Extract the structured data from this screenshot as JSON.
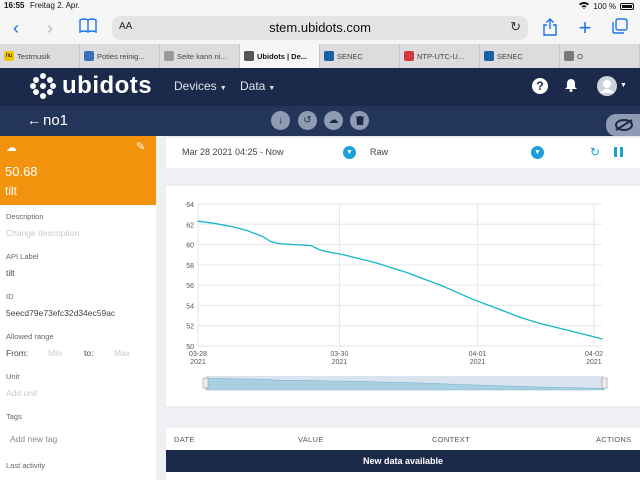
{
  "status_bar": {
    "time": "16:55",
    "date": "Freitag 2. Apr.",
    "battery": "100 %"
  },
  "browser": {
    "aa_label": "AA",
    "url": "stem.ubidots.com",
    "tabs": [
      {
        "label": "Testmusik",
        "favicon_color": "#f5c400",
        "favicon_text": "nu"
      },
      {
        "label": "Poties reinig...",
        "favicon_color": "#3a6fc0",
        "favicon_text": ""
      },
      {
        "label": "Seite kann ni...",
        "favicon_color": "#9a9a9a",
        "favicon_text": ""
      },
      {
        "label": "Ubidots | De...",
        "favicon_color": "#555555",
        "favicon_text": ""
      },
      {
        "label": "SENEC",
        "favicon_color": "#1b5ea8",
        "favicon_text": ""
      },
      {
        "label": "NTP-UTC-U...",
        "favicon_color": "#d23b3b",
        "favicon_text": ""
      },
      {
        "label": "SENEC",
        "favicon_color": "#1b5ea8",
        "favicon_text": ""
      },
      {
        "label": "O",
        "favicon_color": "#7a7a7a",
        "favicon_text": ""
      }
    ],
    "active_tab": 3
  },
  "header": {
    "logo_text": "ubidots",
    "nav": [
      {
        "label": "Devices"
      },
      {
        "label": "Data"
      }
    ]
  },
  "device": {
    "name": "no1"
  },
  "variable": {
    "value": "50.68",
    "name": "tilt",
    "description_label": "Description",
    "description_placeholder": "Change description",
    "api_label_title": "API Label",
    "api_label": "tilt",
    "id_title": "ID",
    "id": "5eecd79e73efc32d34ec59ac",
    "range_title": "Allowed range",
    "from_label": "From:",
    "min_placeholder": "Min",
    "to_label": "to:",
    "max_placeholder": "Max",
    "unit_title": "Unit",
    "unit_placeholder": "Add unit",
    "tags_title": "Tags",
    "tags_placeholder": "Add new tag",
    "last_activity_title": "Last activity"
  },
  "filters": {
    "date_range": "Mar 28 2021 04:25 - Now",
    "aggregation": "Raw"
  },
  "table": {
    "columns": [
      "DATE",
      "VALUE",
      "CONTEXT",
      "ACTIONS"
    ],
    "banner": "New data available"
  },
  "colors": {
    "accent": "#1ba1d8",
    "line": "#17b5c8",
    "orange": "#f2920d",
    "navy": "#1b2a4a"
  },
  "chart_data": {
    "type": "line",
    "title": "",
    "xlabel": "",
    "ylabel": "",
    "ylim": [
      50,
      64
    ],
    "yticks": [
      50,
      52,
      54,
      56,
      58,
      60,
      62,
      64
    ],
    "xlim": [
      0,
      5
    ],
    "xticks": [
      {
        "t": 0,
        "label": "03-28",
        "year": "2021"
      },
      {
        "t": 1.75,
        "label": "03-30",
        "year": "2021"
      },
      {
        "t": 3.46,
        "label": "04-01",
        "year": "2021"
      },
      {
        "t": 4.9,
        "label": "04-02",
        "year": "2021"
      }
    ],
    "x": [
      0,
      0.2,
      0.4,
      0.6,
      0.8,
      0.9,
      1.0,
      1.2,
      1.4,
      1.5,
      1.6,
      1.8,
      2.0,
      2.2,
      2.4,
      2.6,
      2.8,
      3.0,
      3.2,
      3.4,
      3.6,
      3.8,
      4.0,
      4.2,
      4.4,
      4.6,
      4.8,
      5.0
    ],
    "values": [
      62.3,
      62.1,
      61.8,
      61.4,
      60.8,
      60.3,
      60.1,
      60.0,
      59.9,
      59.5,
      59.3,
      59.0,
      58.6,
      58.2,
      57.7,
      57.2,
      56.6,
      56.0,
      55.3,
      54.6,
      54.0,
      53.4,
      52.8,
      52.3,
      51.9,
      51.5,
      51.1,
      50.7
    ]
  }
}
